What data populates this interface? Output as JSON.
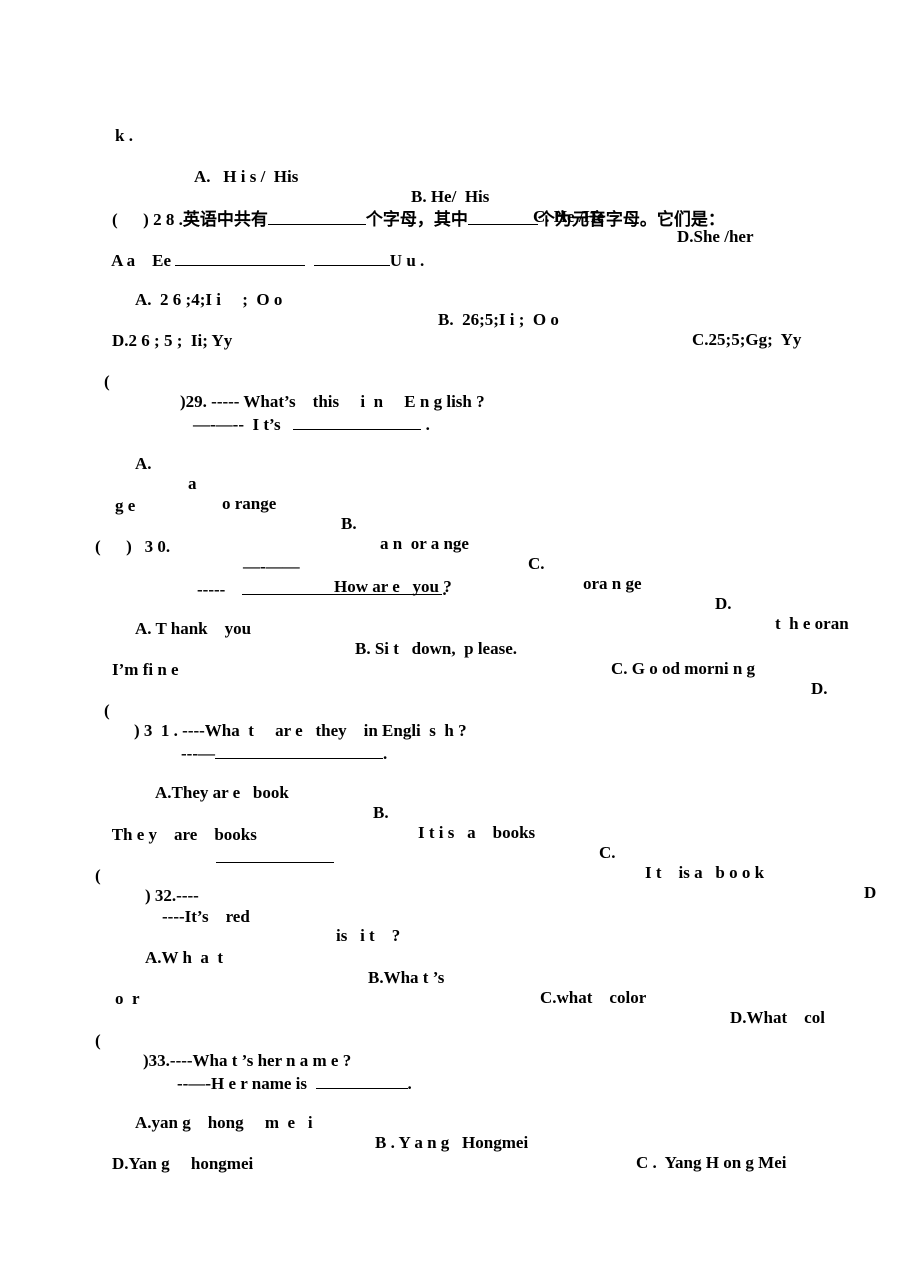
{
  "document": {
    "lines": [
      {
        "id": "l01",
        "segments": [
          "k ."
        ]
      },
      {
        "id": "l02",
        "segments": [
          "A.   H i s /  His",
          "B. He/  His",
          "C. He /He",
          "D.She /her"
        ]
      },
      {
        "id": "l03",
        "segments": [
          "(      ) 2 8 .英语中共有",
          "个字母，其中",
          "个为元音字母。它们是："
        ]
      },
      {
        "id": "l04",
        "segments": [
          "A a    Ee",
          "U u ."
        ]
      },
      {
        "id": "l05",
        "segments": [
          "A.  2 6 ;4;I i     ;  O o",
          "B.  26;5;I i ;  O o",
          "C.25;5;Gg;  Yy"
        ]
      },
      {
        "id": "l06",
        "segments": [
          "D.2 6 ; 5 ;  Ii; Yy"
        ]
      },
      {
        "id": "l07",
        "segments": [
          "(",
          ")29. ----- What’s    this     i  n     E n g lish ?"
        ]
      },
      {
        "id": "l08",
        "segments": [
          "—-—--  I t’s",
          "."
        ]
      },
      {
        "id": "l09",
        "segments": [
          "A.",
          "a",
          "o range",
          "B.",
          "a n  or a nge",
          "C.",
          "ora n ge",
          "D.",
          "t  h e oran"
        ]
      },
      {
        "id": "l10",
        "segments": [
          "g e"
        ]
      },
      {
        "id": "l11",
        "segments": [
          "(      )   3 0.",
          "—-——",
          "How ar e   you ?"
        ]
      },
      {
        "id": "l12",
        "segments": [
          "-----",
          "."
        ]
      },
      {
        "id": "l13",
        "segments": [
          "A. T hank    you",
          "B. Si t   down,  p lease.",
          "C. G o od morni n g",
          "D."
        ]
      },
      {
        "id": "l14",
        "segments": [
          "I’m fi n e"
        ]
      },
      {
        "id": "l15",
        "segments": [
          "(",
          ") 3  1 . ----Wha  t     ar e   they    in Engli  s  h ?"
        ]
      },
      {
        "id": "l16",
        "segments": [
          "---—",
          "."
        ]
      },
      {
        "id": "l17",
        "segments": [
          "A.They ar e   book",
          "B.",
          "I t i s   a    books",
          "C.",
          "I t    is a   b o o k",
          "D"
        ]
      },
      {
        "id": "l18",
        "segments": [
          "Th e y    are    books"
        ]
      },
      {
        "id": "l19",
        "segments": [
          "(",
          ") 32.----",
          "is   i t    ?"
        ]
      },
      {
        "id": "l20",
        "segments": [
          "----It’s    red"
        ]
      },
      {
        "id": "l21",
        "segments": [
          "A.W h  a  t",
          "B.Wha t ’s",
          "C.what    color",
          "D.What    col"
        ]
      },
      {
        "id": "l22",
        "segments": [
          "o  r"
        ]
      },
      {
        "id": "l23",
        "segments": [
          "(",
          ")33.----Wha t ’s her n a m e ?"
        ]
      },
      {
        "id": "l24",
        "segments": [
          "--—-H e r name is",
          "."
        ]
      },
      {
        "id": "l25",
        "segments": [
          "A.yan g    hong     m  e   i",
          "B . Y a n g   Hongmei",
          "C .  Yang H on g Mei"
        ]
      },
      {
        "id": "l26",
        "segments": [
          "D.Yan g     hongmei"
        ]
      }
    ]
  }
}
